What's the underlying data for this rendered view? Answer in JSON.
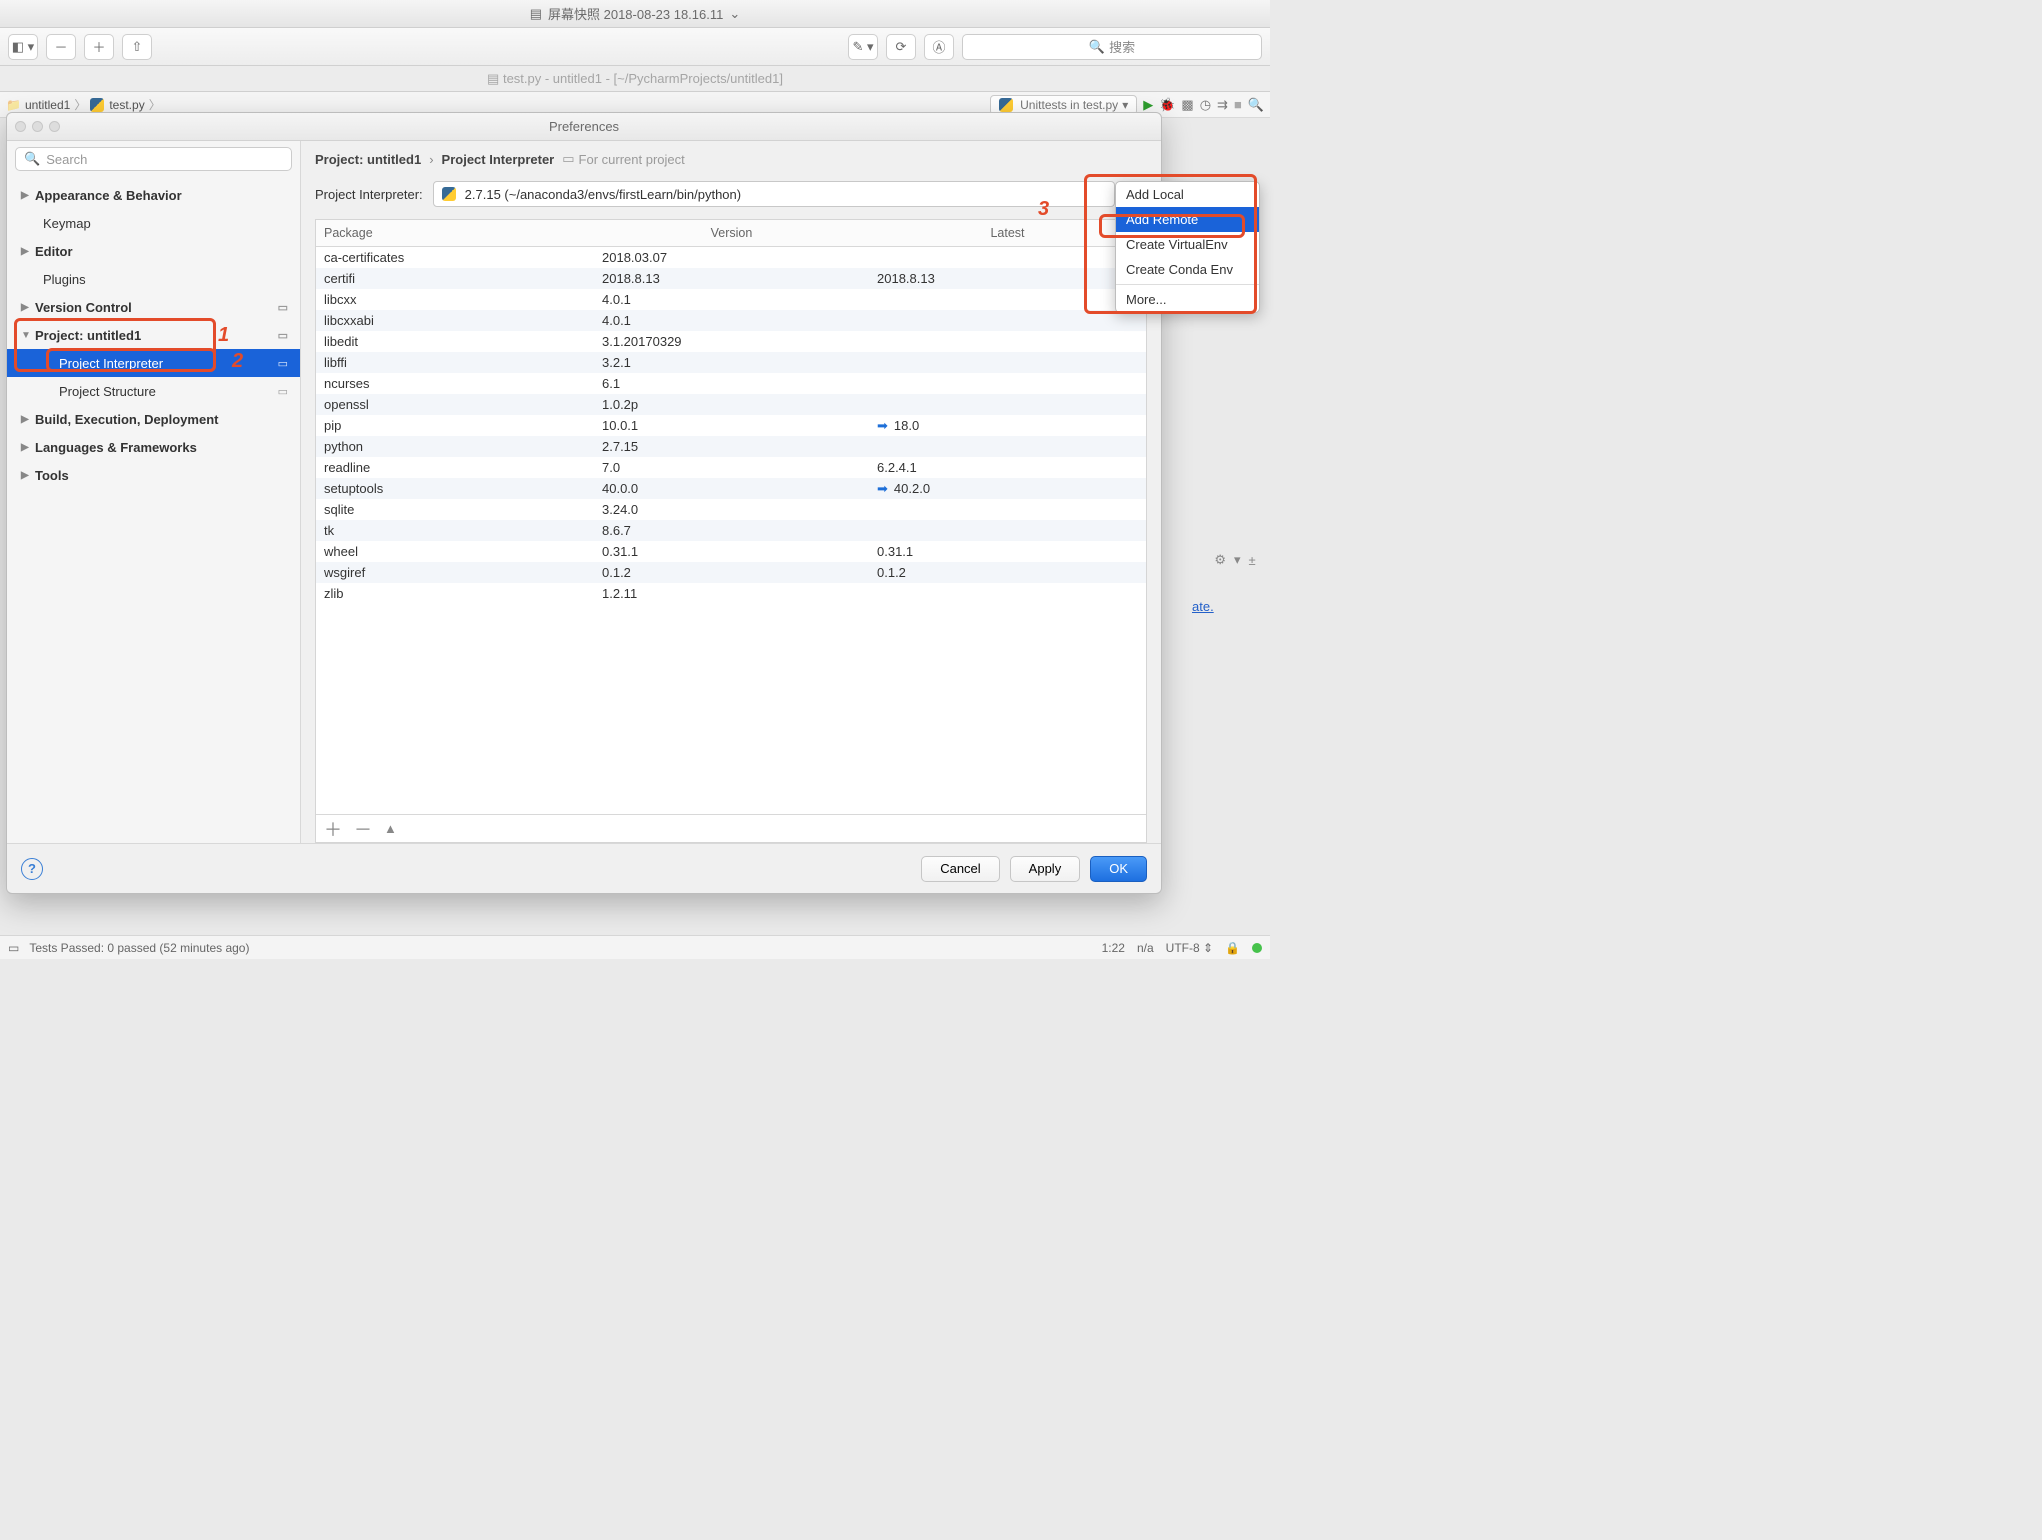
{
  "mac": {
    "screenshot_title": "屏幕快照 2018-08-23 18.16.11",
    "search_placeholder": "搜索"
  },
  "ide": {
    "faded_title": "test.py - untitled1 - [~/PycharmProjects/untitled1]",
    "breadcrumb_project": "untitled1",
    "breadcrumb_file": "test.py",
    "run_config": "Unittests in test.py"
  },
  "prefs": {
    "title": "Preferences",
    "search_placeholder": "Search",
    "tree": {
      "appearance": "Appearance & Behavior",
      "keymap": "Keymap",
      "editor": "Editor",
      "plugins": "Plugins",
      "vcs": "Version Control",
      "project": "Project: untitled1",
      "project_interpreter": "Project Interpreter",
      "project_structure": "Project Structure",
      "build": "Build, Execution, Deployment",
      "lang": "Languages & Frameworks",
      "tools": "Tools"
    },
    "header": {
      "project": "Project: untitled1",
      "section": "Project Interpreter",
      "for_current": "For current project"
    },
    "interpreter_label": "Project Interpreter:",
    "interpreter_value": "2.7.15 (~/anaconda3/envs/firstLearn/bin/python)",
    "cols": {
      "pkg": "Package",
      "ver": "Version",
      "lat": "Latest"
    },
    "packages": [
      {
        "name": "ca-certificates",
        "version": "2018.03.07",
        "latest": ""
      },
      {
        "name": "certifi",
        "version": "2018.8.13",
        "latest": "2018.8.13"
      },
      {
        "name": "libcxx",
        "version": "4.0.1",
        "latest": ""
      },
      {
        "name": "libcxxabi",
        "version": "4.0.1",
        "latest": ""
      },
      {
        "name": "libedit",
        "version": "3.1.20170329",
        "latest": ""
      },
      {
        "name": "libffi",
        "version": "3.2.1",
        "latest": ""
      },
      {
        "name": "ncurses",
        "version": "6.1",
        "latest": ""
      },
      {
        "name": "openssl",
        "version": "1.0.2p",
        "latest": ""
      },
      {
        "name": "pip",
        "version": "10.0.1",
        "latest": "18.0",
        "upgrade": true
      },
      {
        "name": "python",
        "version": "2.7.15",
        "latest": ""
      },
      {
        "name": "readline",
        "version": "7.0",
        "latest": "6.2.4.1"
      },
      {
        "name": "setuptools",
        "version": "40.0.0",
        "latest": "40.2.0",
        "upgrade": true
      },
      {
        "name": "sqlite",
        "version": "3.24.0",
        "latest": ""
      },
      {
        "name": "tk",
        "version": "8.6.7",
        "latest": ""
      },
      {
        "name": "wheel",
        "version": "0.31.1",
        "latest": "0.31.1"
      },
      {
        "name": "wsgiref",
        "version": "0.1.2",
        "latest": "0.1.2"
      },
      {
        "name": "zlib",
        "version": "1.2.11",
        "latest": ""
      }
    ],
    "buttons": {
      "cancel": "Cancel",
      "apply": "Apply",
      "ok": "OK"
    },
    "annotations": {
      "one": "1",
      "two": "2",
      "three": "3"
    }
  },
  "menu": {
    "add_local": "Add Local",
    "add_remote": "Add Remote",
    "create_venv": "Create VirtualEnv",
    "create_conda": "Create Conda Env",
    "more": "More..."
  },
  "status": {
    "tests": "Tests Passed: 0 passed (52 minutes ago)",
    "pos": "1:22",
    "na": "n/a",
    "enc": "UTF-8"
  },
  "misc": {
    "ate": "ate."
  }
}
